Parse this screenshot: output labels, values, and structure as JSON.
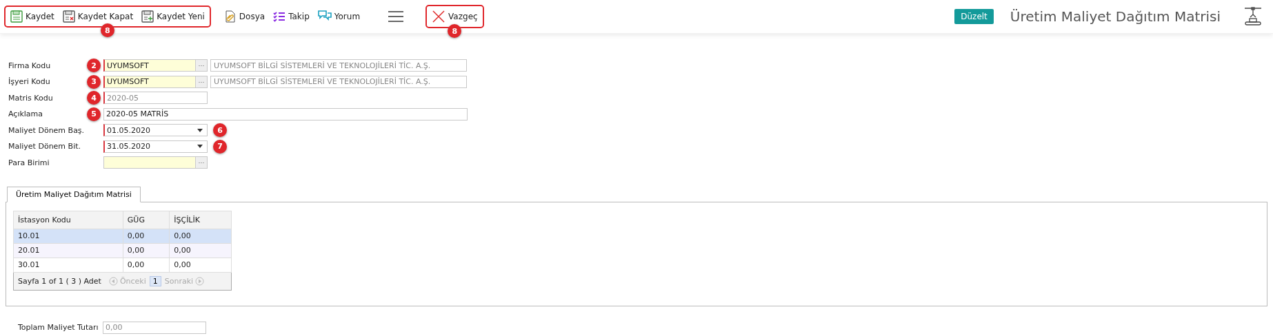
{
  "toolbar": {
    "groups": [
      {
        "outlined": true,
        "badge": "8",
        "buttons": [
          "Kaydet",
          "Kaydet Kapat",
          "Kaydet Yeni"
        ]
      },
      {
        "outlined": false,
        "buttons": [
          "Dosya",
          "Takip",
          "Yorum"
        ]
      },
      {
        "kind": "menu"
      },
      {
        "outlined": true,
        "badge": "8",
        "buttons": [
          "Vazgeç"
        ]
      }
    ],
    "mode_badge": "Düzelt",
    "title": "Üretim Maliyet Dağıtım Matrisi"
  },
  "form": {
    "fields": [
      {
        "kind": "lookup",
        "label": "Firma Kodu",
        "badge": "2",
        "value": "UYUMSOFT",
        "required": true,
        "button_label": "···",
        "description": "UYUMSOFT BİLGİ SİSTEMLERİ VE TEKNOLOJİLERİ TİC. A.Ş."
      },
      {
        "kind": "lookup",
        "label": "İşyeri Kodu",
        "badge": "3",
        "value": "UYUMSOFT",
        "required": true,
        "button_label": "···",
        "description": "UYUMSOFT BİLGİ SİSTEMLERİ VE TEKNOLOJİLERİ TİC. A.Ş."
      },
      {
        "kind": "readonly",
        "label": "Matris Kodu",
        "badge": "4",
        "value": "2020-05",
        "required": true
      },
      {
        "kind": "wide",
        "label": "Açıklama",
        "badge": "5",
        "value": "2020-05 MATRİS",
        "required": false
      },
      {
        "kind": "date",
        "label": "Maliyet Dönem Baş.",
        "badge": "6",
        "value": "01.05.2020",
        "required": true
      },
      {
        "kind": "date",
        "label": "Maliyet Dönem Bit.",
        "badge": "7",
        "value": "31.05.2020",
        "required": true
      },
      {
        "kind": "lookup",
        "label": "Para Birimi",
        "required": false,
        "button_label": "···"
      }
    ]
  },
  "tabs": [
    {
      "label": "Üretim Maliyet Dağıtım Matrisi",
      "selected": true
    }
  ],
  "table": {
    "columns": [
      "İstasyon Kodu",
      "GÜG",
      "İŞÇİLİK"
    ],
    "rows": [
      {
        "cells": [
          "10.01",
          "0,00",
          "0,00"
        ],
        "selected": true
      },
      {
        "cells": [
          "20.01",
          "0,00",
          "0,00"
        ],
        "selected": false
      },
      {
        "cells": [
          "30.01",
          "0,00",
          "0,00"
        ],
        "selected": false
      }
    ],
    "pager": {
      "summary": "Sayfa 1 of 1 ( 3 ) Adet",
      "prev": "Önceki",
      "next": "Sonraki",
      "prev_disabled": true,
      "next_disabled": true,
      "pages": [
        {
          "label": "1",
          "selected": true
        }
      ]
    }
  },
  "total": {
    "label": "Toplam Maliyet Tutarı",
    "value": "0,00"
  }
}
